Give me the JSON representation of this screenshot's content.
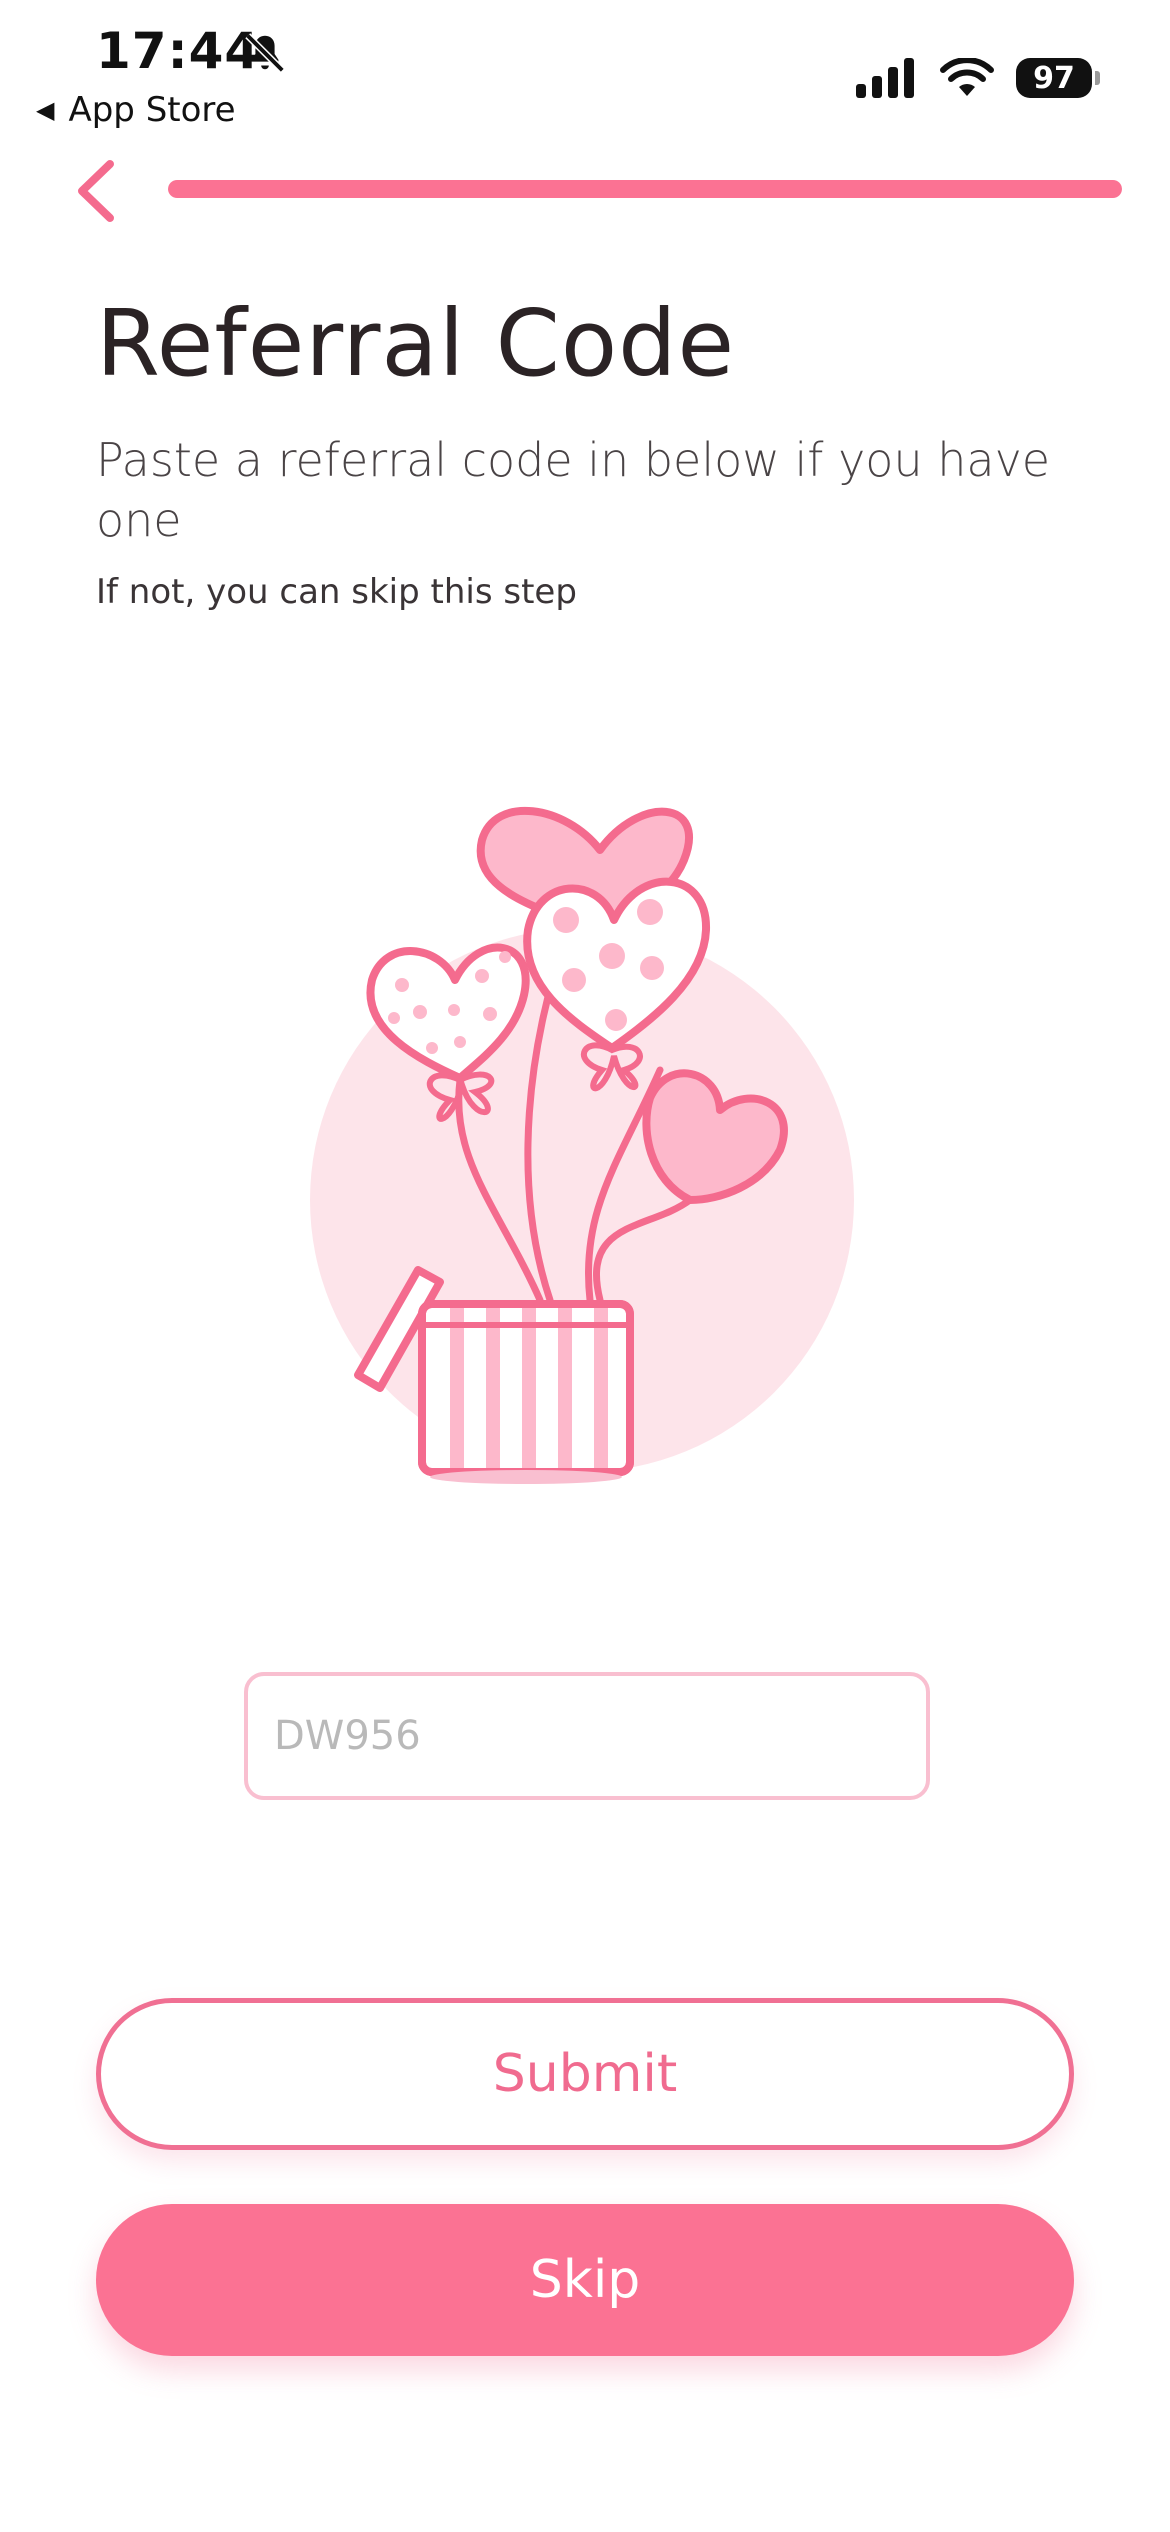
{
  "status_bar": {
    "time": "17:44",
    "back_app": "App Store",
    "battery": "97"
  },
  "progress": {
    "fraction": 1.0
  },
  "page": {
    "title": "Referral Code",
    "subtitle": "Paste a referral code in below if you have one",
    "hint": "If not, you can skip this step"
  },
  "referral_input": {
    "value": "",
    "placeholder": "DW956"
  },
  "buttons": {
    "submit": "Submit",
    "skip": "Skip"
  },
  "colors": {
    "accent": "#fb7293",
    "accent_border": "#f07093",
    "input_border": "#f9bfd0",
    "illustration_bg": "#fde4ea"
  },
  "icons": {
    "back": "chevron-left-icon",
    "notifications": "bell-slash-icon",
    "signal": "cellular-signal-icon",
    "wifi": "wifi-icon",
    "battery": "battery-icon",
    "illustration": "heart-balloons-gift-box-illustration"
  }
}
